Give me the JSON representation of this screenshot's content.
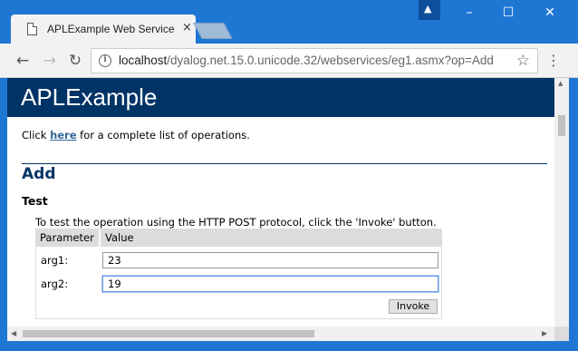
{
  "browser": {
    "tab_title": "APLExample Web Service",
    "tab_close": "×",
    "profile_icon": "person-icon",
    "window_controls": {
      "minimize": "–",
      "maximize": "☐",
      "close": "✕"
    }
  },
  "toolbar": {
    "back": "←",
    "forward": "→",
    "reload": "↻",
    "url_host": "localhost",
    "url_path": "/dyalog.net.15.0.unicode.32/webservices/eg1.asmx?op=Add",
    "bookmark": "☆",
    "menu": "⋮",
    "info": "i"
  },
  "page": {
    "service_name": "APLExample",
    "intro_prefix": "Click ",
    "intro_link": "here",
    "intro_suffix": " for a complete list of operations.",
    "operation": "Add",
    "test_heading": "Test",
    "test_description": "To test the operation using the HTTP POST protocol, click the 'Invoke' button.",
    "table": {
      "header_parameter": "Parameter",
      "header_value": "Value",
      "rows": [
        {
          "label": "arg1:",
          "value": "23"
        },
        {
          "label": "arg2:",
          "value": "19"
        }
      ]
    },
    "invoke_label": "Invoke"
  },
  "colors": {
    "titlebar": "#1f77d4",
    "banner": "#003366",
    "link": "#336699"
  }
}
